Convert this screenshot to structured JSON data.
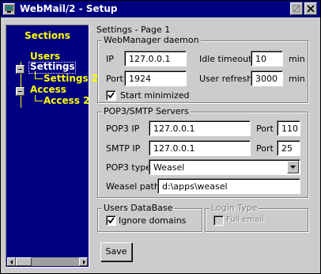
{
  "window": {
    "title": "WebMail/2 - Setup"
  },
  "sidebar": {
    "title": "Sections",
    "items": [
      {
        "label": "Users",
        "level": 0
      },
      {
        "label": "Settings",
        "level": 0,
        "selected": true
      },
      {
        "label": "Settings 2",
        "level": 1
      },
      {
        "label": "Access",
        "level": 0
      },
      {
        "label": "Access 2",
        "level": 1
      }
    ]
  },
  "page": {
    "title": "Settings - Page 1"
  },
  "webmanager": {
    "legend": "WebManager daemon",
    "ip_label": "IP",
    "ip_value": "127.0.0.1",
    "port_label": "Port",
    "port_value": "1924",
    "idle_label": "Idle timeout",
    "idle_value": "10",
    "idle_unit": "min",
    "refresh_label": "User refresh",
    "refresh_value": "3000",
    "refresh_unit": "min",
    "start_min_label": "Start minimized",
    "start_min_checked": true
  },
  "pop3": {
    "legend": "POP3/SMTP Servers",
    "pop3ip_label": "POP3 IP",
    "pop3ip_value": "127.0.0.1",
    "pop3port_label": "Port",
    "pop3port_value": "110",
    "smtpip_label": "SMTP IP",
    "smtpip_value": "127.0.0.1",
    "smtpport_label": "Port",
    "smtpport_value": "25",
    "type_label": "POP3 type",
    "type_value": "Weasel",
    "path_label": "Weasel path",
    "path_value": "d:\\apps\\weasel"
  },
  "usersdb": {
    "legend": "Users DataBase",
    "ignore_label": "Ignore domains",
    "ignore_checked": true
  },
  "logintype": {
    "legend": "Login Type",
    "fullemail_label": "Full email",
    "fullemail_checked": false,
    "enabled": false
  },
  "actions": {
    "save_label": "Save"
  },
  "icons": {
    "window": "computer-icon",
    "restore": "restore-icon",
    "close": "close-icon"
  }
}
